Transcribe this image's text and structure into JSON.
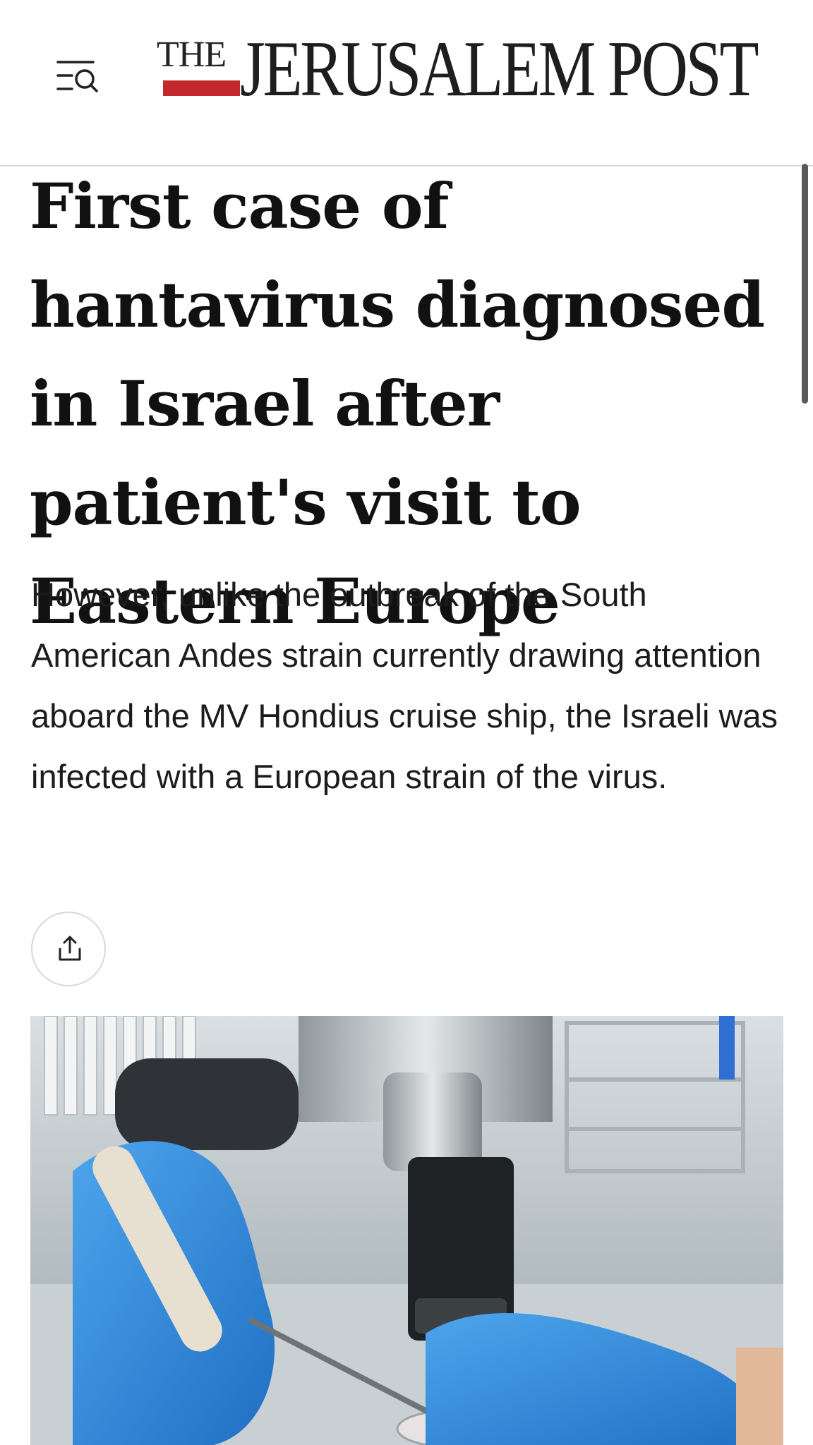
{
  "header": {
    "logo_prefix": "THE",
    "logo_name": "JERUSALEM POST",
    "menu_icon": "menu-search-icon",
    "accent_color": "#c3282d"
  },
  "article": {
    "headline": "First case of hantavirus diagnosed in Israel after patient's visit to Eastern Europe",
    "subtitle": "However, unlike the outbreak of the South American Andes strain currently drawing attention aboard the MV Hondius cruise ship, the Israeli was infected with a European strain of the virus.",
    "share_icon": "share-icon",
    "image_icon": "lab-microscope-photo"
  }
}
